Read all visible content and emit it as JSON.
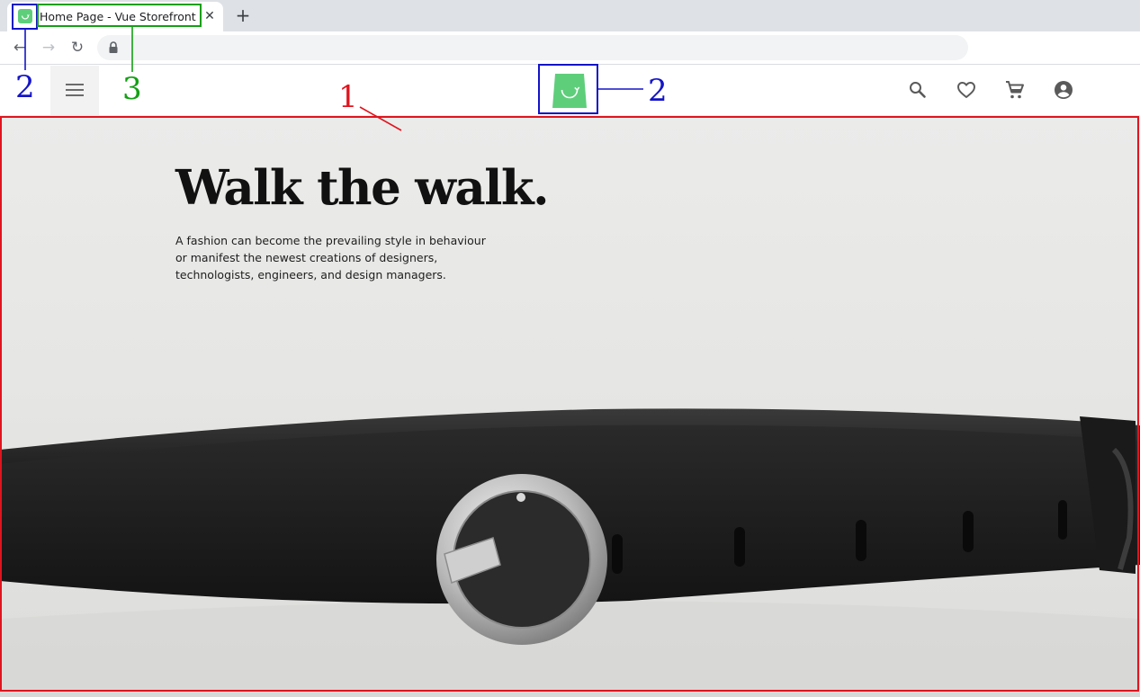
{
  "browser": {
    "tab": {
      "title": "Home Page - Vue Storefront",
      "close_label": "✕",
      "favicon": "vue-storefront-bag-icon"
    },
    "new_tab_label": "+",
    "nav": {
      "back": "←",
      "forward": "→",
      "reload": "↻"
    },
    "address": {
      "value": "",
      "secure_icon": "lock-icon"
    }
  },
  "header": {
    "menu_icon": "hamburger-menu-icon",
    "logo": "vue-storefront-bag-logo",
    "icons": [
      "search-icon",
      "heart-icon",
      "cart-icon",
      "account-icon"
    ]
  },
  "hero": {
    "title": "Walk the walk.",
    "description": "A fashion can become the prevailing style in behaviour or manifest the newest creations of designers, technologists, engineers, and design managers."
  },
  "annotations": [
    {
      "label": "1",
      "color": "#e0141e"
    },
    {
      "label": "2",
      "color": "#1414c8"
    },
    {
      "label": "3",
      "color": "#14a014"
    },
    {
      "label": "2",
      "color": "#1414c8"
    }
  ],
  "colors": {
    "brand_green": "#5ece7b",
    "annotation_red": "#e0141e",
    "annotation_blue": "#1414c8",
    "annotation_green": "#14a014"
  }
}
